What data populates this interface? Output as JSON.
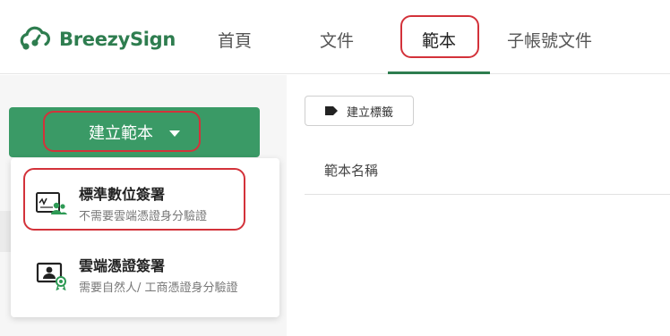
{
  "brand": {
    "name": "BreezySign",
    "color": "#2e7d4f"
  },
  "nav": {
    "items": [
      {
        "label": "首頁"
      },
      {
        "label": "文件"
      },
      {
        "label": "範本"
      },
      {
        "label": "子帳號文件"
      }
    ],
    "active_index": 2
  },
  "sidebar": {
    "create_button_label": "建立範本",
    "dropdown": [
      {
        "title": "標準數位簽署",
        "subtitle": "不需要雲端憑證身分驗證",
        "icon": "standard-signature-icon"
      },
      {
        "title": "雲端憑證簽署",
        "subtitle": "需要自然人/ 工商憑證身分驗證",
        "icon": "cloud-certificate-icon"
      }
    ]
  },
  "main": {
    "create_tag_label": "建立標籤",
    "column_header": "範本名稱"
  },
  "colors": {
    "accent": "#3a9a66",
    "highlight": "#d3323a"
  }
}
